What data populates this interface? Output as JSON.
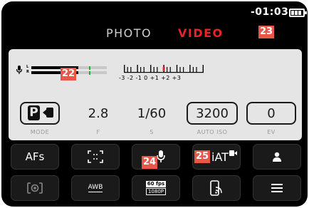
{
  "status": {
    "time": "-01:03"
  },
  "tabs": {
    "photo": "PHOTO",
    "video": "VIDEO"
  },
  "callouts": {
    "c22": "22",
    "c23": "23",
    "c24": "24",
    "c25": "25"
  },
  "meter": {
    "left_label": "L",
    "right_label": "R",
    "level_left": 0.62,
    "level_right": 0.62
  },
  "ev_scale": {
    "labels": "-3  -2  -1   0  +1  +2  +3",
    "indicator": 0
  },
  "params": {
    "mode": {
      "value": "P",
      "label": "MODE"
    },
    "aperture": {
      "value": "2.8",
      "label": "F"
    },
    "shutter": {
      "value": "1/60",
      "label": "S"
    },
    "iso": {
      "value": "3200",
      "label": "AUTO ISO"
    },
    "ev": {
      "value": "0",
      "label": "EV"
    }
  },
  "grid": {
    "af_mode": "AFs",
    "ois": "iAT",
    "awb": "AWB",
    "fps_top": "60 fps",
    "fps_bottom": "1080P"
  },
  "colors": {
    "video_tab": "#e8232a",
    "callout": "#e8574a",
    "meter_tick": "#16b03a",
    "panel": "#e5e5e5"
  },
  "icons": {
    "battery": "battery-icon",
    "mic": "microphone-icon",
    "metering": "metering-field-icon",
    "af_field": "af-field-icon",
    "profile": "user-profile-icon",
    "stabilizer_video": "video-camera-icon",
    "spot": "spot-metering-icon",
    "phone": "smartphone-connect-icon",
    "menu": "menu-icon"
  }
}
